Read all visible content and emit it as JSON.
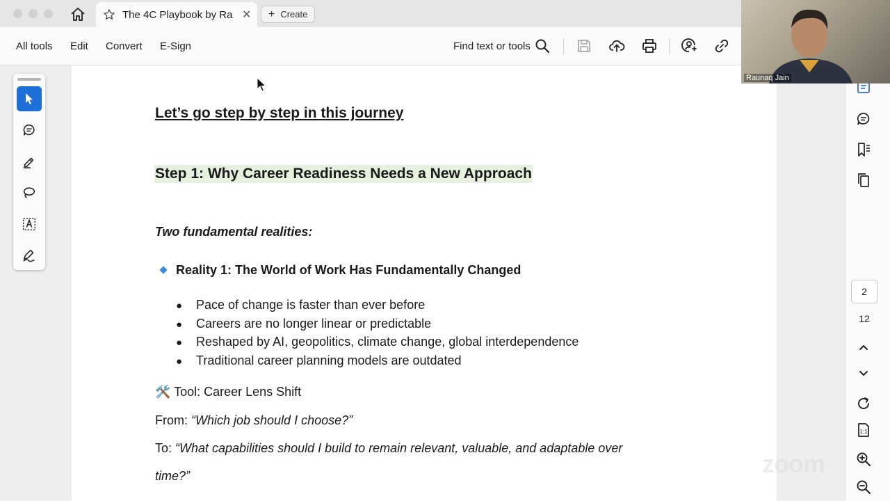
{
  "tab": {
    "title": "The 4C Playbook by Ra...",
    "close": "✕"
  },
  "create_label": "Create",
  "menu": {
    "all_tools": "All tools",
    "edit": "Edit",
    "convert": "Convert",
    "esign": "E-Sign"
  },
  "find_label": "Find text or tools",
  "document": {
    "heading": "Let’s go step by step in this journey",
    "step1": "Step 1: Why Career Readiness Needs a New Approach",
    "two_realities": "Two fundamental realities:",
    "reality1": "Reality 1: The World of Work Has Fundamentally Changed",
    "bullets": [
      "Pace of change is faster than ever before",
      "Careers are no longer linear or predictable",
      "Reshaped by AI, geopolitics, climate change, global interdependence",
      "Traditional career planning models are outdated"
    ],
    "tool_line": "🛠️ Tool: Career Lens Shift",
    "from_label": "From: ",
    "from_quote": "“Which job should I choose?”",
    "to_label": "To: ",
    "to_quote": "“What capabilities should I build to remain relevant, valuable, and adaptable over",
    "to_quote_cont": "time?”"
  },
  "pagination": {
    "current": "2",
    "total": "12"
  },
  "webcam": {
    "name": "Raunaq Jain"
  },
  "watermark": "zoom",
  "colors": {
    "accent": "#1f6fd8",
    "highlight": "#e5f0df",
    "diamond": "#3a8ed8"
  }
}
